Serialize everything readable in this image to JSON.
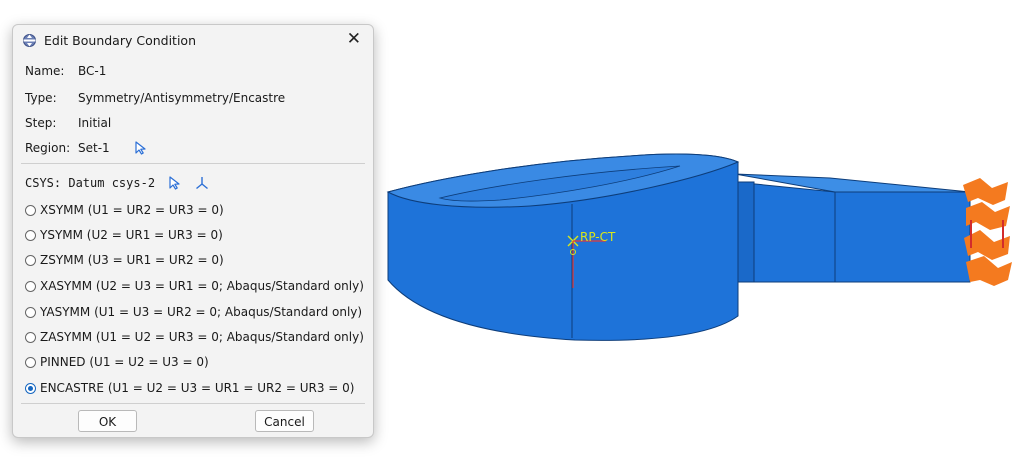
{
  "dialog": {
    "title": "Edit Boundary Condition",
    "close_glyph": "✕",
    "name_label": "Name:",
    "name_value": "BC-1",
    "type_label": "Type:",
    "type_value": "Symmetry/Antisymmetry/Encastre",
    "step_label": "Step:",
    "step_value": "Initial",
    "region_label": "Region:",
    "region_value": "Set-1",
    "csys_text": "CSYS: Datum csys-2",
    "options": [
      {
        "label": "XSYMM (U1 = UR2 = UR3 = 0)",
        "selected": false
      },
      {
        "label": "YSYMM (U2 = UR1 = UR3 = 0)",
        "selected": false
      },
      {
        "label": "ZSYMM (U3 = UR1 = UR2 = 0)",
        "selected": false
      },
      {
        "label": "XASYMM (U2 = U3 = UR1 = 0; Abaqus/Standard only)",
        "selected": false
      },
      {
        "label": "YASYMM (U1 = U3 = UR2 = 0; Abaqus/Standard only)",
        "selected": false
      },
      {
        "label": "ZASYMM (U1 = U2 = UR3 = 0; Abaqus/Standard only)",
        "selected": false
      },
      {
        "label": "PINNED (U1 = U2 = U3 = 0)",
        "selected": false
      },
      {
        "label": "ENCASTRE (U1 = U2 = U3 = UR1 = UR2 = UR3 = 0)",
        "selected": true
      }
    ],
    "ok_label": "OK",
    "cancel_label": "Cancel"
  },
  "viewport": {
    "reference_point_label": "RP-CT",
    "colors": {
      "part_face": "#1e73d9",
      "part_dark": "#155cb5",
      "bc_marker": "#f47a1f",
      "rp_marker": "#d8e61c"
    }
  },
  "icons": [
    "boundary-condition-icon",
    "close-icon",
    "select-cursor-icon",
    "datum-csys-icon"
  ]
}
